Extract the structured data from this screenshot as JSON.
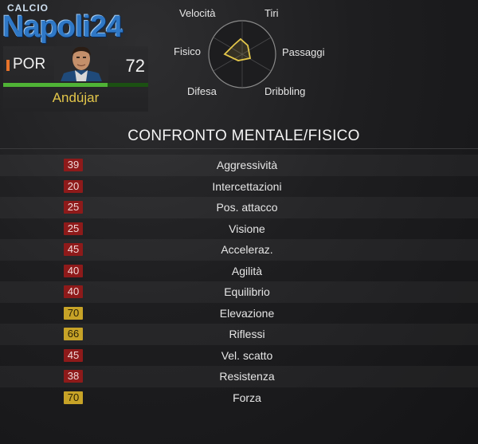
{
  "logo": {
    "small_text": "CALCIO",
    "big_text": "Napoli24"
  },
  "player": {
    "position": "POR",
    "rating": "72",
    "name": "Andújar",
    "rating_fraction": 0.72,
    "colors": {
      "position_marker": "#e8732a",
      "name": "#e3c64a",
      "bar": "#4fb336"
    }
  },
  "radar": {
    "labels": {
      "velocita": "Velocità",
      "tiri": "Tiri",
      "passaggi": "Passaggi",
      "dribbling": "Dribbling",
      "difesa": "Difesa",
      "fisico": "Fisico"
    },
    "polygon_color": "#e3c64a"
  },
  "comparison": {
    "title": "CONFRONTO MENTALE/FISICO",
    "rows": [
      {
        "value": "39",
        "label": "Aggressività",
        "level": "low"
      },
      {
        "value": "20",
        "label": "Intercettazioni",
        "level": "low"
      },
      {
        "value": "25",
        "label": "Pos. attacco",
        "level": "low"
      },
      {
        "value": "25",
        "label": "Visione",
        "level": "low"
      },
      {
        "value": "45",
        "label": "Acceleraz.",
        "level": "low"
      },
      {
        "value": "40",
        "label": "Agilità",
        "level": "low"
      },
      {
        "value": "40",
        "label": "Equilibrio",
        "level": "low"
      },
      {
        "value": "70",
        "label": "Elevazione",
        "level": "high"
      },
      {
        "value": "66",
        "label": "Riflessi",
        "level": "high"
      },
      {
        "value": "45",
        "label": "Vel. scatto",
        "level": "low"
      },
      {
        "value": "38",
        "label": "Resistenza",
        "level": "low"
      },
      {
        "value": "70",
        "label": "Forza",
        "level": "high"
      }
    ],
    "colors": {
      "low": "#8e1a1a",
      "high": "#c7a327"
    }
  }
}
